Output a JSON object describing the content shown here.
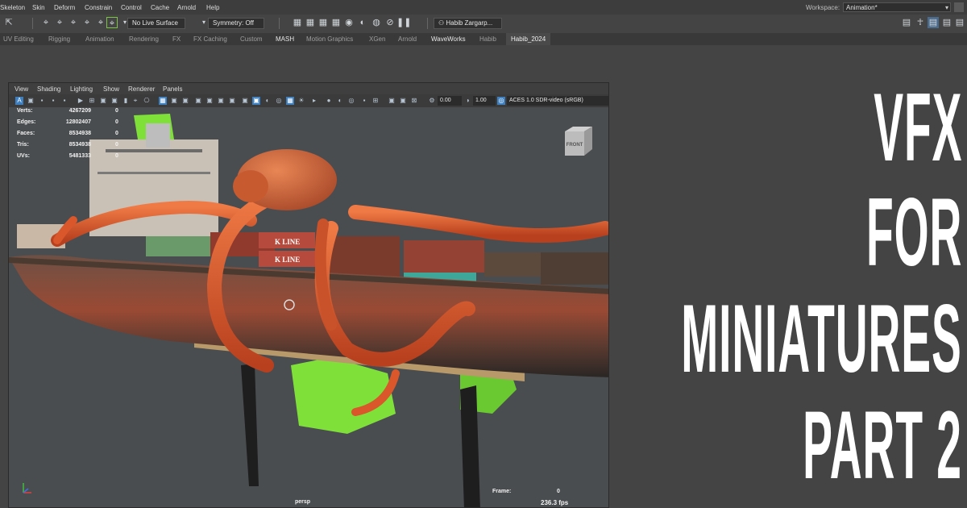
{
  "menu": {
    "items": [
      "Skeleton",
      "Skin",
      "Deform",
      "Constrain",
      "Control",
      "Cache",
      "Arnold",
      "Help"
    ],
    "workspace_label": "Workspace:",
    "workspace_value": "Animation*"
  },
  "statusline": {
    "live_surface": "No Live Surface",
    "symmetry": "Symmetry: Off",
    "user": "Habib Zargarp..."
  },
  "shelf": {
    "tabs": [
      "UV Editing",
      "Rigging",
      "Animation",
      "Rendering",
      "FX",
      "FX Caching",
      "Custom",
      "MASH",
      "Motion Graphics",
      "XGen",
      "Arnold",
      "WaveWorks",
      "Habib",
      "Habib_2024"
    ],
    "active_tab": "Habib_2024"
  },
  "viewport": {
    "menu": [
      "View",
      "Shading",
      "Lighting",
      "Show",
      "Renderer",
      "Panels"
    ],
    "exposure": "0.00",
    "gamma": "1.00",
    "color_space": "ACES 1.0 SDR-video (sRGB)",
    "hud": [
      {
        "label": "Verts:",
        "value": "4267209",
        "second": "0"
      },
      {
        "label": "Edges:",
        "value": "12802407",
        "second": "0"
      },
      {
        "label": "Faces:",
        "value": "8534938",
        "second": "0"
      },
      {
        "label": "Tris:",
        "value": "8534938",
        "second": "0"
      },
      {
        "label": "UVs:",
        "value": "5481333",
        "second": "0"
      }
    ],
    "viewcube_face": "FRONT",
    "frame_label": "Frame:",
    "frame_value": "0",
    "fps": "236.3 fps",
    "camera": "persp",
    "container_labels": [
      "K LINE",
      "K LINE"
    ]
  },
  "title": {
    "line1": "VFX",
    "line2": "FOR",
    "line3": "MINIATURES",
    "line4": "PART 2"
  },
  "colors": {
    "octopus": "#e0602f",
    "hull_red": "#9a4a34",
    "foliage": "#7fe03a",
    "ui_bg": "#444444",
    "accent": "#3d8fd6"
  }
}
